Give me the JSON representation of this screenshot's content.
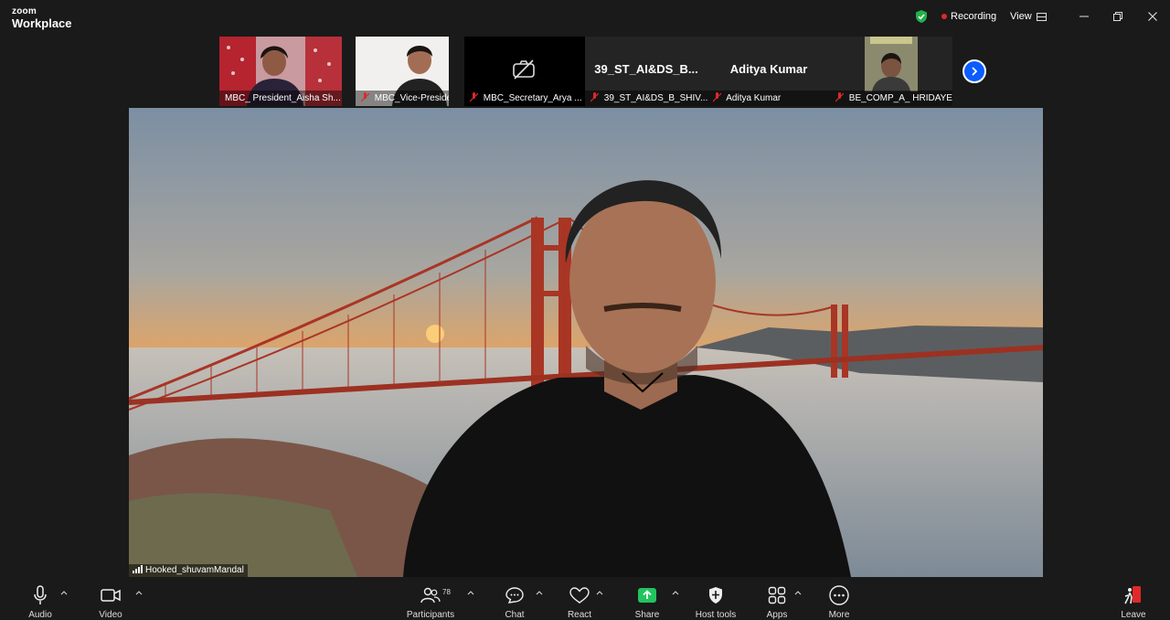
{
  "app": {
    "brand_small": "zoom",
    "brand_large": "Workplace"
  },
  "titlebar": {
    "recording": "Recording",
    "view": "View"
  },
  "participants_strip": [
    {
      "name": "MBC_ President_Aisha Sh...",
      "video": true,
      "muted": false
    },
    {
      "name": "MBC_Vice-President_P...",
      "video": true,
      "muted": true
    },
    {
      "name": "MBC_Secretary_Arya ...",
      "video": false,
      "muted": true
    },
    {
      "name": "39_ST_AI&DS_B_SHIV...",
      "display": "39_ST_AI&DS_B...",
      "video": false,
      "muted": true
    },
    {
      "name": "Aditya Kumar",
      "display": "Aditya Kumar",
      "video": false,
      "muted": true
    },
    {
      "name": "BE_COMP_A_ HRIDAYE...",
      "video": true,
      "muted": true
    }
  ],
  "main_video": {
    "name": "Hooked_shuvamMandal"
  },
  "toolbar": {
    "audio": "Audio",
    "video": "Video",
    "participants": "Participants",
    "participants_count": "78",
    "chat": "Chat",
    "react": "React",
    "share": "Share",
    "host_tools": "Host tools",
    "apps": "Apps",
    "more": "More",
    "leave": "Leave"
  },
  "colors": {
    "accent": "#0b5cff",
    "share_green": "#21c45d",
    "record_red": "#e02828",
    "leave_red": "#e02828"
  }
}
